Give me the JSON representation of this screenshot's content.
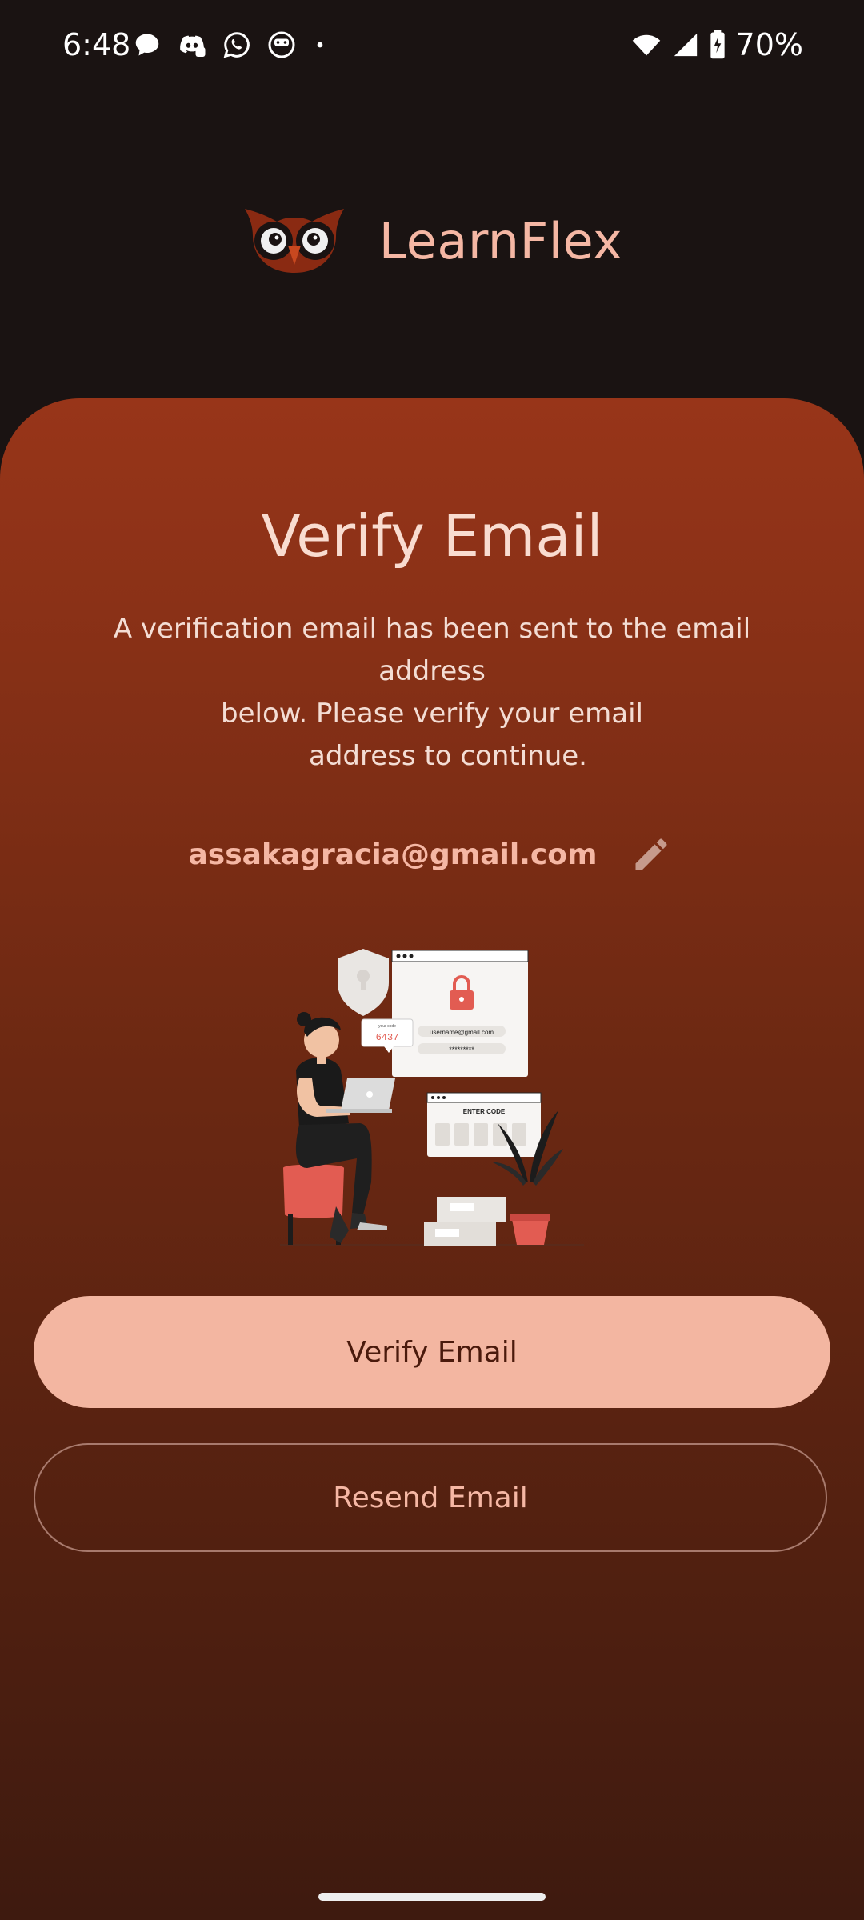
{
  "status_bar": {
    "time": "6:48",
    "battery": "70%",
    "notification_icons": [
      "chat-bubble-icon",
      "discord-icon",
      "whatsapp-icon",
      "app-face-icon",
      "dot-icon"
    ],
    "system_icons": [
      "wifi-icon",
      "signal-icon",
      "battery-charging-icon"
    ]
  },
  "header": {
    "app_name": "LearnFlex",
    "logo_icon": "owl-logo-icon"
  },
  "card": {
    "title": "Verify Email",
    "description_line1": "A verification email has been sent to the email address",
    "description_line2": "below. Please verify your email",
    "description_line3": "address to continue.",
    "email": "assakagracia@gmail.com",
    "edit_icon": "pencil-icon",
    "illustration": {
      "code_bubble": "6437",
      "code_label": "your code",
      "email_field": "username@gmail.com",
      "password_field": "*********",
      "enter_code_title": "ENTER CODE"
    },
    "verify_button": "Verify Email",
    "resend_button": "Resend Email"
  },
  "colors": {
    "accent": "#f3b6a1",
    "card_top": "#983519",
    "card_bottom": "#3e1a0f",
    "background": "#1a1312"
  }
}
